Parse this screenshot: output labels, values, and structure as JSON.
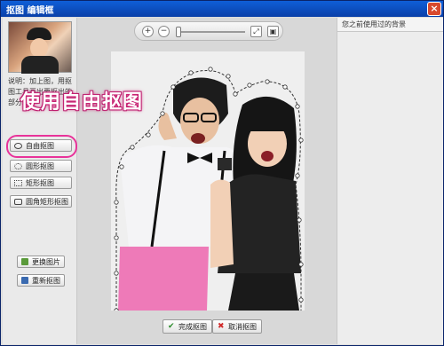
{
  "window": {
    "title": "抠图 编辑框",
    "close_glyph": "×"
  },
  "left": {
    "description": "说明：加上图，用抠图工具画出要抠出的部分。",
    "tools": [
      {
        "label": "自由抠图",
        "icon": "lasso-icon"
      },
      {
        "label": "圆形抠图",
        "icon": "ellipse-icon"
      },
      {
        "label": "矩形抠图",
        "icon": "rectangle-icon"
      },
      {
        "label": "圆角矩形抠图",
        "icon": "rounded-rectangle-icon"
      }
    ],
    "actions": [
      {
        "label": "更换图片",
        "icon": "image-icon"
      },
      {
        "label": "重新抠图",
        "icon": "redo-icon"
      }
    ]
  },
  "callout": {
    "text": "使用自由抠图",
    "color": "#e8339a"
  },
  "zoom": {
    "zoom_in": "+",
    "zoom_out": "−",
    "fit": "⤢",
    "actual": "▣"
  },
  "bottom": {
    "finish_label": "完成抠图",
    "cancel_label": "取消抠图"
  },
  "right": {
    "header": "您之前使用过的背景"
  },
  "colors": {
    "accent": "#e8339a",
    "titlebar": "#0f5fd8"
  }
}
